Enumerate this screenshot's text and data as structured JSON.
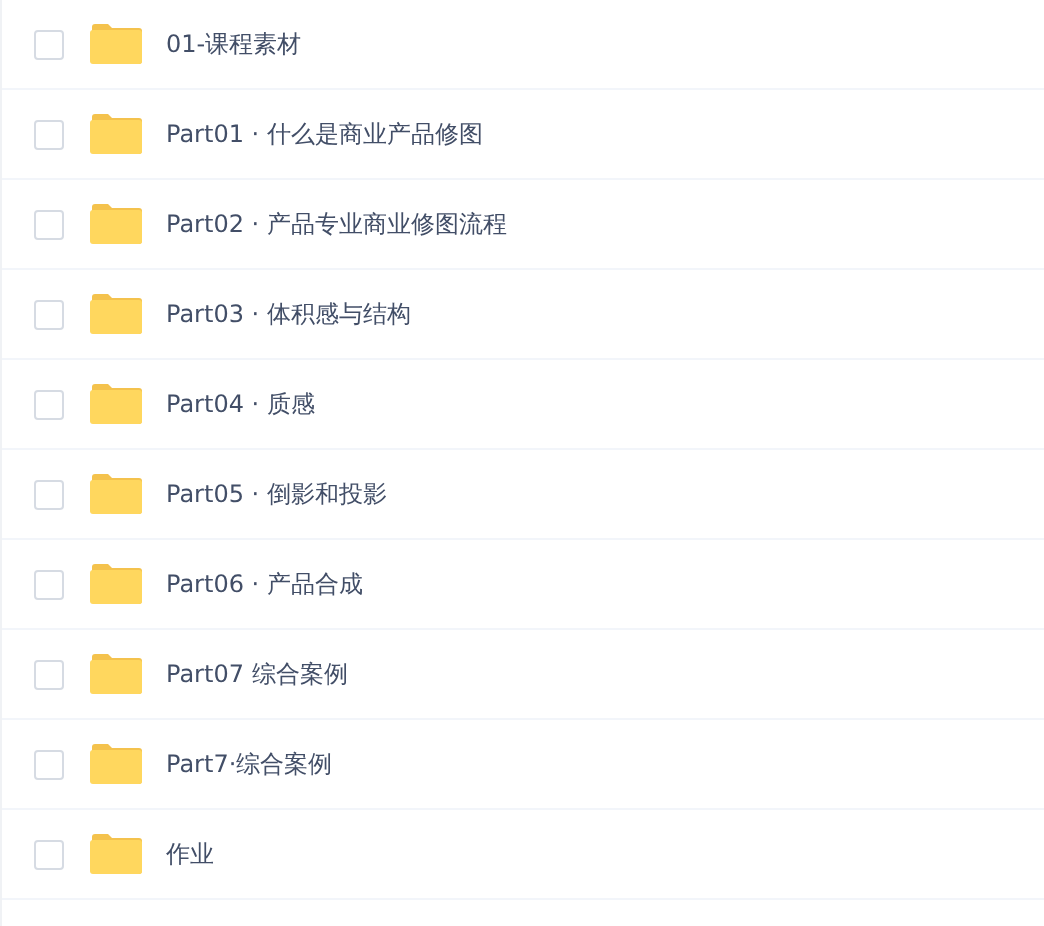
{
  "files": [
    {
      "name": "01-课程素材",
      "checked": false
    },
    {
      "name": "Part01 · 什么是商业产品修图",
      "checked": false
    },
    {
      "name": "Part02 · 产品专业商业修图流程",
      "checked": false
    },
    {
      "name": "Part03 · 体积感与结构",
      "checked": false
    },
    {
      "name": "Part04 · 质感",
      "checked": false
    },
    {
      "name": "Part05 · 倒影和投影",
      "checked": false
    },
    {
      "name": "Part06 · 产品合成",
      "checked": false
    },
    {
      "name": "Part07 综合案例",
      "checked": false
    },
    {
      "name": "Part7·综合案例",
      "checked": false
    },
    {
      "name": "作业",
      "checked": false
    }
  ]
}
